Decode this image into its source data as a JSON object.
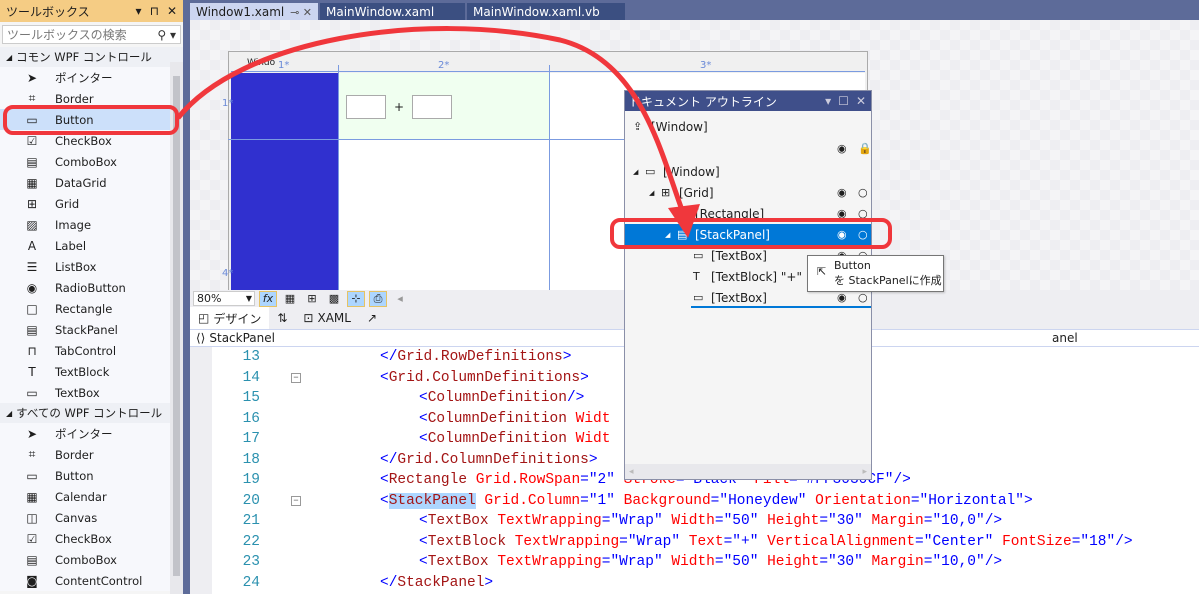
{
  "toolbox": {
    "title": "ツールボックス",
    "search_placeholder": "ツールボックスの検索",
    "sections": [
      {
        "label": "コモン WPF コントロール",
        "items": [
          {
            "label": "ポインター",
            "icon": "pointer-icon"
          },
          {
            "label": "Border",
            "icon": "border-icon"
          },
          {
            "label": "Button",
            "icon": "button-icon"
          },
          {
            "label": "CheckBox",
            "icon": "checkbox-icon"
          },
          {
            "label": "ComboBox",
            "icon": "combobox-icon"
          },
          {
            "label": "DataGrid",
            "icon": "datagrid-icon"
          },
          {
            "label": "Grid",
            "icon": "grid-icon"
          },
          {
            "label": "Image",
            "icon": "image-icon"
          },
          {
            "label": "Label",
            "icon": "label-icon"
          },
          {
            "label": "ListBox",
            "icon": "listbox-icon"
          },
          {
            "label": "RadioButton",
            "icon": "radiobutton-icon"
          },
          {
            "label": "Rectangle",
            "icon": "rectangle-icon"
          },
          {
            "label": "StackPanel",
            "icon": "stackpanel-icon"
          },
          {
            "label": "TabControl",
            "icon": "tabcontrol-icon"
          },
          {
            "label": "TextBlock",
            "icon": "textblock-icon"
          },
          {
            "label": "TextBox",
            "icon": "textbox-icon"
          }
        ]
      },
      {
        "label": "すべての WPF コントロール",
        "items": [
          {
            "label": "ポインター",
            "icon": "pointer-icon"
          },
          {
            "label": "Border",
            "icon": "border-icon"
          },
          {
            "label": "Button",
            "icon": "button-icon"
          },
          {
            "label": "Calendar",
            "icon": "calendar-icon"
          },
          {
            "label": "Canvas",
            "icon": "canvas-icon"
          },
          {
            "label": "CheckBox",
            "icon": "checkbox-icon"
          },
          {
            "label": "ComboBox",
            "icon": "combobox-icon"
          },
          {
            "label": "ContentControl",
            "icon": "contentcontrol-icon"
          }
        ]
      }
    ]
  },
  "tabs": [
    {
      "label": "Window1.xaml"
    },
    {
      "label": "MainWindow.xaml"
    },
    {
      "label": "MainWindow.xaml.vb"
    }
  ],
  "designer": {
    "window_title": "Windo",
    "col_headers": [
      "1*",
      "2*",
      "3*"
    ],
    "row_headers": [
      "1*",
      "4*"
    ],
    "plus": "+"
  },
  "toolbar": {
    "zoom": "80%",
    "fx": "fx"
  },
  "view_tabs": {
    "design": "デザイン",
    "swap": "⇅",
    "xaml": "XAML"
  },
  "breadcrumb": {
    "left": "StackPanel",
    "right": "anel"
  },
  "code": {
    "lines": [
      {
        "n": "13",
        "indent": 1,
        "t": [
          [
            "p",
            "</"
          ],
          [
            "e",
            "Grid.RowDefinitions"
          ],
          [
            "p",
            ">"
          ]
        ]
      },
      {
        "n": "14",
        "indent": 1,
        "fold": true,
        "t": [
          [
            "p",
            "<"
          ],
          [
            "e",
            "Grid.ColumnDefinitions"
          ],
          [
            "p",
            ">"
          ]
        ]
      },
      {
        "n": "15",
        "indent": 2,
        "t": [
          [
            "p",
            "<"
          ],
          [
            "e",
            "ColumnDefinition"
          ],
          [
            "p",
            "/>"
          ]
        ]
      },
      {
        "n": "16",
        "indent": 2,
        "t": [
          [
            "p",
            "<"
          ],
          [
            "e",
            "ColumnDefinition"
          ],
          [
            "a",
            " Widt"
          ]
        ]
      },
      {
        "n": "17",
        "indent": 2,
        "t": [
          [
            "p",
            "<"
          ],
          [
            "e",
            "ColumnDefinition"
          ],
          [
            "a",
            " Widt"
          ]
        ]
      },
      {
        "n": "18",
        "indent": 1,
        "t": [
          [
            "p",
            "</"
          ],
          [
            "e",
            "Grid.ColumnDefinitions"
          ],
          [
            "p",
            ">"
          ]
        ]
      },
      {
        "n": "19",
        "indent": 1,
        "t": [
          [
            "p",
            "<"
          ],
          [
            "e",
            "Rectangle"
          ],
          [
            "a",
            " Grid.RowSpan"
          ],
          [
            "p",
            "="
          ],
          [
            "v",
            "\"2\" "
          ],
          [
            "a",
            "Stroke"
          ],
          [
            "p",
            "="
          ],
          [
            "v",
            "\"Black\" "
          ],
          [
            "a",
            "Fill"
          ],
          [
            "p",
            "="
          ],
          [
            "v",
            "\"#FF3030CF\""
          ],
          [
            "p",
            "/>"
          ]
        ]
      },
      {
        "n": "20",
        "indent": 1,
        "fold": true,
        "t": [
          [
            "p",
            "<"
          ],
          [
            "e hl",
            "StackPanel"
          ],
          [
            "a",
            " Grid.Column"
          ],
          [
            "p",
            "="
          ],
          [
            "v",
            "\"1\""
          ],
          [
            "a",
            " Background"
          ],
          [
            "p",
            "="
          ],
          [
            "v",
            "\"Honeydew\""
          ],
          [
            "a",
            " Orientation"
          ],
          [
            "p",
            "="
          ],
          [
            "v",
            "\"Horizontal\""
          ],
          [
            "p",
            ">"
          ]
        ]
      },
      {
        "n": "21",
        "indent": 2,
        "t": [
          [
            "p",
            "<"
          ],
          [
            "e",
            "TextBox"
          ],
          [
            "a",
            " TextWrapping"
          ],
          [
            "p",
            "="
          ],
          [
            "v",
            "\"Wrap\""
          ],
          [
            "a",
            " Width"
          ],
          [
            "p",
            "="
          ],
          [
            "v",
            "\"50\""
          ],
          [
            "a",
            " Height"
          ],
          [
            "p",
            "="
          ],
          [
            "v",
            "\"30\""
          ],
          [
            "a",
            " Margin"
          ],
          [
            "p",
            "="
          ],
          [
            "v",
            "\"10,0\""
          ],
          [
            "p",
            "/>"
          ]
        ]
      },
      {
        "n": "22",
        "indent": 2,
        "t": [
          [
            "p",
            "<"
          ],
          [
            "e",
            "TextBlock"
          ],
          [
            "a",
            " TextWrapping"
          ],
          [
            "p",
            "="
          ],
          [
            "v",
            "\"Wrap\""
          ],
          [
            "a",
            " Text"
          ],
          [
            "p",
            "="
          ],
          [
            "v",
            "\"+\""
          ],
          [
            "a",
            " VerticalAlignment"
          ],
          [
            "p",
            "="
          ],
          [
            "v",
            "\"Center\""
          ],
          [
            "a",
            " FontSize"
          ],
          [
            "p",
            "="
          ],
          [
            "v",
            "\"18\""
          ],
          [
            "p",
            "/>"
          ]
        ]
      },
      {
        "n": "23",
        "indent": 2,
        "t": [
          [
            "p",
            "<"
          ],
          [
            "e",
            "TextBox"
          ],
          [
            "a",
            " TextWrapping"
          ],
          [
            "p",
            "="
          ],
          [
            "v",
            "\"Wrap\""
          ],
          [
            "a",
            " Width"
          ],
          [
            "p",
            "="
          ],
          [
            "v",
            "\"50\""
          ],
          [
            "a",
            " Height"
          ],
          [
            "p",
            "="
          ],
          [
            "v",
            "\"30\""
          ],
          [
            "a",
            " Margin"
          ],
          [
            "p",
            "="
          ],
          [
            "v",
            "\"10,0\""
          ],
          [
            "p",
            "/>"
          ]
        ]
      },
      {
        "n": "24",
        "indent": 1,
        "t": [
          [
            "p",
            "</"
          ],
          [
            "e",
            "StackPanel"
          ],
          [
            "p",
            ">"
          ]
        ]
      }
    ]
  },
  "outline": {
    "title": "ドキュメント アウトライン",
    "rows": [
      {
        "label": "[Window]",
        "icon": "upload-icon",
        "depth": 0,
        "expander": false
      },
      {
        "label": "",
        "depth": 0,
        "eye": true,
        "lock": true
      },
      {
        "label": "[Window]",
        "icon": "window-icon",
        "depth": 0,
        "expander": true
      },
      {
        "label": "[Grid]",
        "icon": "grid-icon",
        "depth": 1,
        "expander": true,
        "eye": true
      },
      {
        "label": "[Rectangle]",
        "icon": "rectangle-icon",
        "depth": 2,
        "eye": true
      },
      {
        "label": "[StackPanel]",
        "icon": "stackpanel-icon",
        "depth": 2,
        "expander": true,
        "eye": true,
        "selected": true
      },
      {
        "label": "[TextBox]",
        "icon": "textbox-icon",
        "depth": 3,
        "eye": true
      },
      {
        "label": "[TextBlock] \"+\"",
        "icon": "textblock-icon",
        "depth": 3
      },
      {
        "label": "[TextBox]",
        "icon": "textbox-icon",
        "depth": 3,
        "eye": true
      }
    ]
  },
  "tooltip": {
    "line1": "Button",
    "line2": "を StackPanelに作成"
  },
  "colors": {
    "annotation": "#f0373c",
    "selection": "#0078d7",
    "rectangle_fill": "#3030cf",
    "honeydew": "#f0fff0"
  }
}
